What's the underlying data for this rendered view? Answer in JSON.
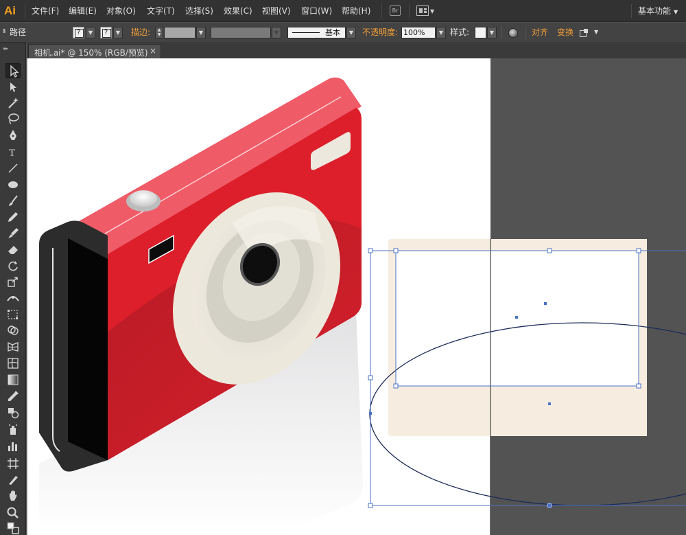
{
  "app": {
    "logo": "Ai"
  },
  "menu": {
    "items": [
      "文件(F)",
      "编辑(E)",
      "对象(O)",
      "文字(T)",
      "选择(S)",
      "效果(C)",
      "视图(V)",
      "窗口(W)",
      "帮助(H)"
    ],
    "bridge_label": "Br",
    "workspace": "基本功能"
  },
  "control": {
    "object_type": "路径",
    "fill_placeholder": "?",
    "stroke_placeholder": "?",
    "stroke_label": "描边:",
    "brush_label": "基本",
    "opacity_label": "不透明度:",
    "opacity_value": "100%",
    "style_label": "样式:",
    "align_label": "对齐",
    "transform_label": "变换"
  },
  "document": {
    "tab_label": "相机.ai* @ 150% (RGB/预览)",
    "close_glyph": "×"
  },
  "toolbar": {
    "tools": [
      "selection-tool",
      "direct-selection-tool",
      "magic-wand-tool",
      "lasso-tool",
      "pen-tool",
      "type-tool",
      "line-segment-tool",
      "ellipse-tool",
      "paintbrush-tool",
      "pencil-tool",
      "blob-brush-tool",
      "eraser-tool",
      "rotate-tool",
      "scale-tool",
      "width-tool",
      "free-transform-tool",
      "shape-builder-tool",
      "perspective-grid-tool",
      "mesh-tool",
      "gradient-tool",
      "eyedropper-tool",
      "blend-tool",
      "symbol-sprayer-tool",
      "column-graph-tool",
      "artboard-tool",
      "slice-tool",
      "hand-tool",
      "zoom-tool"
    ],
    "active_tool": "selection-tool"
  },
  "colors": {
    "camera_red": "#d91d29",
    "camera_top": "#f06270",
    "camera_side": "#2d2d2d",
    "lens_cream": "#e9e6dc",
    "selection_blue": "#4a72c4",
    "rect_beige": "#f6ede0",
    "menubar_bg": "#323232",
    "control_bg": "#434343",
    "accent_orange": "#f29d38"
  }
}
